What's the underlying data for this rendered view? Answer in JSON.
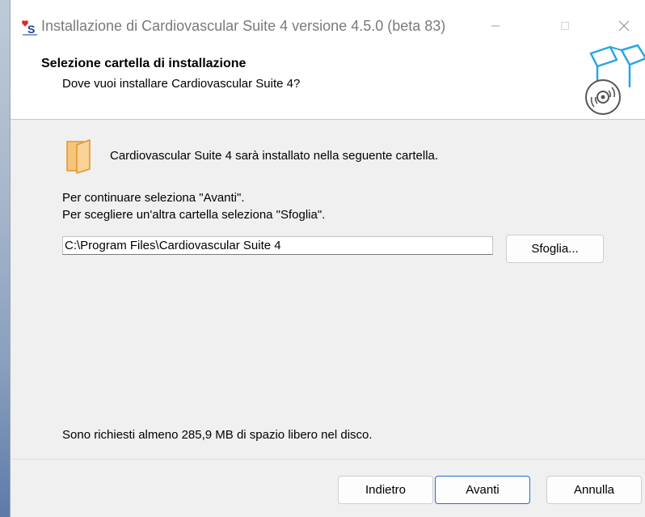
{
  "window": {
    "title": "Installazione di Cardiovascular Suite 4 versione 4.5.0 (beta 83)",
    "controls": {
      "minimize_icon": "minimize-icon",
      "maximize_icon": "maximize-icon",
      "close_icon": "close-icon"
    }
  },
  "header": {
    "title": "Selezione cartella di installazione",
    "subtitle": "Dove vuoi installare Cardiovascular Suite 4?",
    "icon": "package-disc-icon"
  },
  "body": {
    "info": "Cardiovascular Suite 4 sarà installato nella seguente cartella.",
    "instruction_1": "Per continuare seleziona \"Avanti\".",
    "instruction_2": "Per scegliere un'altra cartella seleziona \"Sfoglia\".",
    "install_path": "C:\\Program Files\\Cardiovascular Suite 4",
    "browse_label": "Sfoglia...",
    "space_required": "Sono richiesti almeno 285,9 MB di spazio libero nel disco."
  },
  "footer": {
    "back_label": "Indietro",
    "next_label": "Avanti",
    "cancel_label": "Annulla"
  },
  "colors": {
    "accent": "#1f6ecd",
    "icon_blue": "#2aa6e0",
    "folder_orange": "#f0a840",
    "logo_red": "#e2262b",
    "window_bg": "#f0f0f0"
  }
}
